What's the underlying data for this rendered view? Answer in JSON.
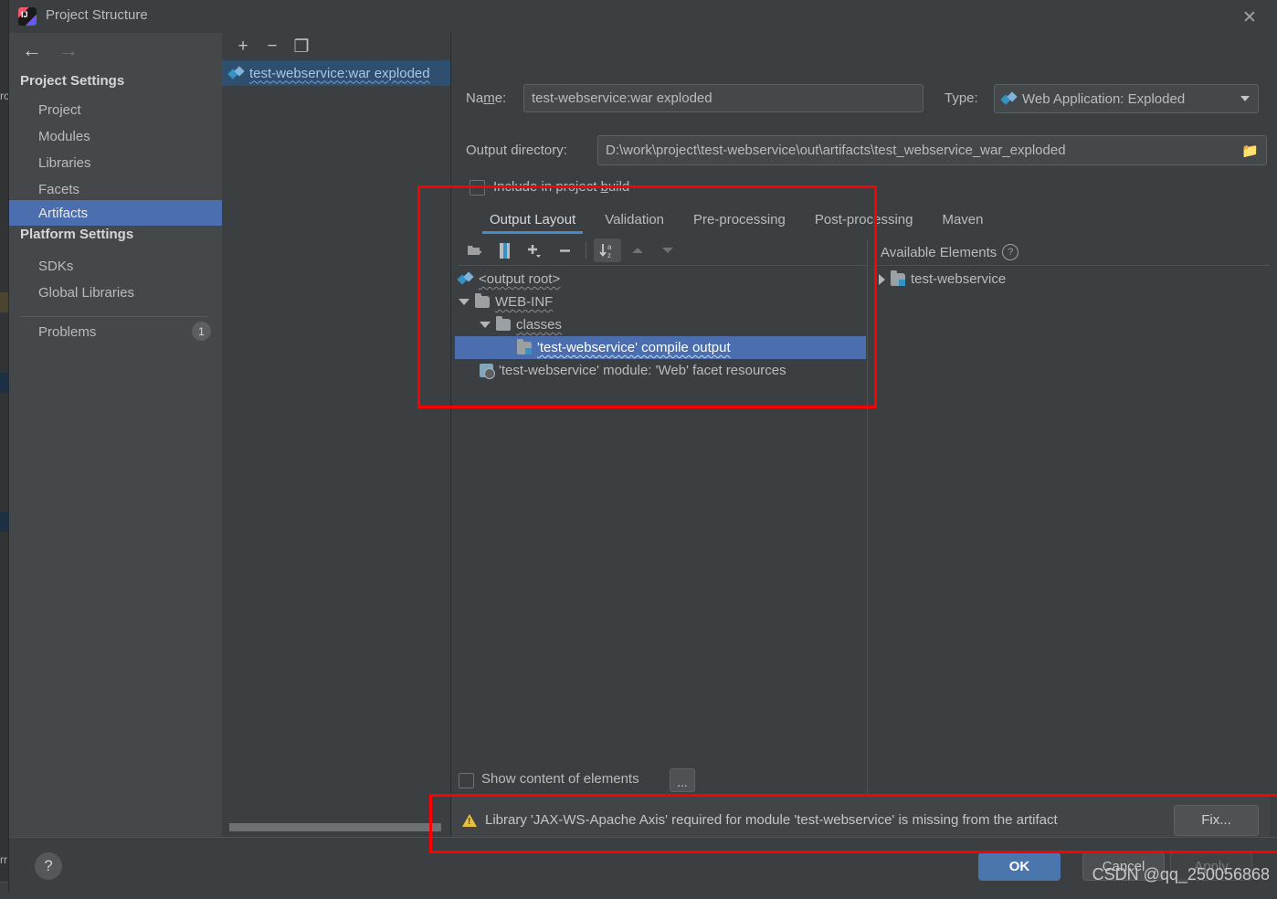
{
  "ide_background": {
    "gutter_marks": [
      "0",
      "0",
      "0"
    ],
    "left_fragments": [
      "ro",
      "rr"
    ],
    "bottom_text": ""
  },
  "dialog": {
    "title": "Project Structure",
    "icon_name": "intellij-idea-logo",
    "close_label": "✕"
  },
  "nav": {
    "back_label": "←",
    "forward_label": "→",
    "groups": [
      {
        "label": "Project Settings",
        "items": [
          {
            "label": "Project",
            "selected": false
          },
          {
            "label": "Modules",
            "selected": false
          },
          {
            "label": "Libraries",
            "selected": false
          },
          {
            "label": "Facets",
            "selected": false
          },
          {
            "label": "Artifacts",
            "selected": true
          }
        ]
      },
      {
        "label": "Platform Settings",
        "items": [
          {
            "label": "SDKs",
            "selected": false
          },
          {
            "label": "Global Libraries",
            "selected": false
          }
        ]
      }
    ],
    "problems": {
      "label": "Problems",
      "count": "1"
    }
  },
  "artifacts_pane": {
    "toolbar": [
      {
        "name": "add-artifact-button",
        "glyph": "+"
      },
      {
        "name": "remove-artifact-button",
        "glyph": "−"
      },
      {
        "name": "copy-artifact-button",
        "glyph": "❐"
      }
    ],
    "items": [
      {
        "label": "test-webservice:war exploded",
        "selected": true
      }
    ]
  },
  "editor": {
    "name_label": "Name:",
    "name_value": "test-webservice:war exploded",
    "type_label": "Type:",
    "type_value": "Web Application: Exploded",
    "output_dir_label": "Output directory:",
    "output_dir_value": "D:\\work\\project\\test-webservice\\out\\artifacts\\test_webservice_war_exploded",
    "include_in_build_label": "Include in project build",
    "include_in_build_checked": false,
    "tabs": [
      {
        "label": "Output Layout",
        "active": true
      },
      {
        "label": "Validation",
        "active": false
      },
      {
        "label": "Pre-processing",
        "active": false
      },
      {
        "label": "Post-processing",
        "active": false
      },
      {
        "label": "Maven",
        "active": false
      }
    ],
    "layout_toolbar": [
      {
        "name": "create-directory-button",
        "glyph": "🗀",
        "state": "normal"
      },
      {
        "name": "create-archive-button",
        "glyph": "‖",
        "state": "normal"
      },
      {
        "name": "add-copy-of-button",
        "glyph": "+",
        "state": "normal"
      },
      {
        "name": "remove-element-button",
        "glyph": "−",
        "state": "normal"
      },
      {
        "name": "sort-alphabetically-button",
        "glyph": "↓az",
        "state": "toggled"
      },
      {
        "name": "move-up-button",
        "glyph": "▲",
        "state": "disabled"
      },
      {
        "name": "move-down-button",
        "glyph": "▼",
        "state": "disabled"
      }
    ],
    "output_tree": [
      {
        "label": "<output root>",
        "indent": 0,
        "icon": "diamonds",
        "toggle": "none",
        "selected": false
      },
      {
        "label": "WEB-INF",
        "indent": 1,
        "icon": "folder",
        "toggle": "expanded",
        "selected": false
      },
      {
        "label": "classes",
        "indent": 2,
        "icon": "folder",
        "toggle": "expanded",
        "selected": false
      },
      {
        "label": "'test-webservice' compile output",
        "indent": 4,
        "icon": "module",
        "toggle": "none",
        "selected": true
      },
      {
        "label": "'test-webservice' module: 'Web' facet resources",
        "indent": 1,
        "icon": "facet",
        "toggle": "none",
        "selected": false
      }
    ],
    "available_title": "Available Elements",
    "available_help": "?",
    "available_tree": [
      {
        "label": "test-webservice",
        "icon": "module",
        "toggle": "collapsed"
      }
    ],
    "show_content_label": "Show content of elements",
    "show_content_checked": false,
    "dots_button_label": "..."
  },
  "warning": {
    "icon_name": "warning-triangle-icon",
    "text": "Library 'JAX-WS-Apache Axis' required for module 'test-webservice' is missing from the artifact",
    "fix_label": "Fix..."
  },
  "footer": {
    "help_label": "?",
    "ok_label": "OK",
    "cancel_label": "Cancel",
    "apply_label": "Apply"
  },
  "watermark": "CSDN @qq_250056868",
  "colors": {
    "accent_blue": "#4b6eaf",
    "tab_underline": "#4a88c7",
    "warning_yellow": "#e8bf3d",
    "annotation_red": "#ff0000",
    "dialog_bg": "#3c3f41",
    "nav_bg": "#45484a"
  }
}
